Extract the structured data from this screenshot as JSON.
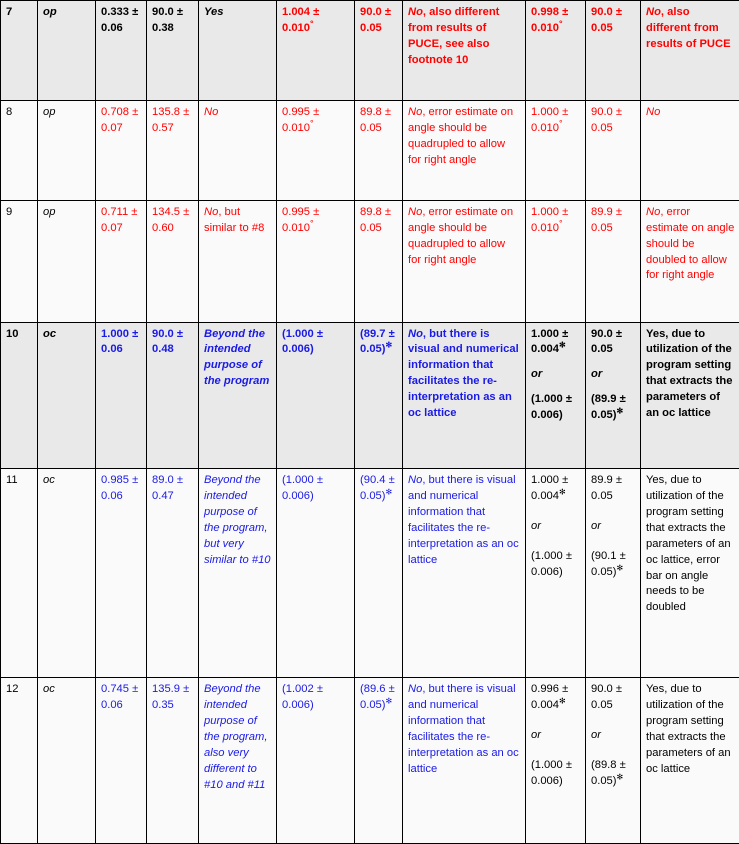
{
  "table": {
    "markers": {
      "degree": "°",
      "star": "✻"
    },
    "colors": {
      "black": "#000000",
      "red": "#ff0000",
      "blue": "#1a1ae6",
      "row_tint_gray": "#e9e9e9",
      "row_tint_white": "#fafafa",
      "border": "#000000"
    },
    "rows": [
      {
        "id": "row-7",
        "tint": "gray",
        "num": "7",
        "lattice": "op",
        "a": "0.333 ± 0.06",
        "b": "90.0 ± 0.38",
        "col5": "Yes",
        "col6": "1.004 ± 0.010°",
        "col7": "90.0 ± 0.05",
        "col8_lead": "No",
        "col8_rest": ", also different from results of PUCE, see also footnote 10",
        "col9": "0.998 ± 0.010°",
        "col10": "90.0 ± 0.05",
        "col11_lead": "No",
        "col11_rest": ", also different from results of PUCE"
      },
      {
        "id": "row-8",
        "tint": "white",
        "num": "8",
        "lattice": "op",
        "a": "0.708 ± 0.07",
        "b": "135.8 ± 0.57",
        "col5": "No",
        "col6": "0.995 ± 0.010°",
        "col7": "89.8 ± 0.05",
        "col8_lead": "No",
        "col8_rest": ", error estimate on angle should be quadrupled to allow for right angle",
        "col9": "1.000 ± 0.010°",
        "col10": "90.0 ± 0.05",
        "col11_lead": "No",
        "col11_rest": ""
      },
      {
        "id": "row-9",
        "tint": "white",
        "num": "9",
        "lattice": "op",
        "a": "0.711 ± 0.07",
        "b": "134.5 ± 0.60",
        "col5_lead": "No",
        "col5_rest": ", but similar to #8",
        "col6": "0.995 ± 0.010°",
        "col7": "89.8 ± 0.05",
        "col8_lead": "No",
        "col8_rest": ", error estimate on angle should be quadrupled to allow for right angle",
        "col9": "1.000 ± 0.010°",
        "col10": "89.9 ± 0.05",
        "col11_lead": "No",
        "col11_rest": ", error estimate on angle should be doubled to allow for right angle"
      },
      {
        "id": "row-10",
        "tint": "gray",
        "num": "10",
        "lattice": "oc",
        "a": "1.000 ± 0.06",
        "b": "90.0 ± 0.48",
        "col5": "Beyond the intended purpose of the program",
        "col6": "(1.000 ± 0.006)",
        "col7": "(89.7 ± 0.05)✻",
        "col8_lead": "No",
        "col8_rest": ", but there is visual and numerical information that facilitates the re-interpretation as an oc lattice",
        "col9_a": "1.000 ± 0.004✻",
        "col9_or": "or",
        "col9_b": "(1.000 ± 0.006)",
        "col10_a": "90.0 ± 0.05",
        "col10_or": "or",
        "col10_b": "(89.9 ± 0.05)✻",
        "col11_lead": "Yes",
        "col11_rest": ", due to utilization of the program setting that extracts the parameters of an oc lattice"
      },
      {
        "id": "row-11",
        "tint": "white",
        "num": "11",
        "lattice": "oc",
        "a": "0.985 ± 0.06",
        "b": "89.0 ± 0.47",
        "col5": "Beyond the intended purpose of the program, but very similar to #10",
        "col6": "(1.000 ± 0.006)",
        "col7": "(90.4 ± 0.05)✻",
        "col8_lead": "No",
        "col8_rest": ", but there is visual and numerical information that facilitates the re-interpretation as an oc lattice",
        "col9_a": "1.000 ± 0.004✻",
        "col9_or": "or",
        "col9_b": "(1.000 ± 0.006)",
        "col10_a": "89.9 ± 0.05",
        "col10_or": "or",
        "col10_b": "(90.1 ± 0.05)✻",
        "col11_lead": "Yes",
        "col11_rest": ", due to utilization of the program setting that extracts the parameters of an oc lattice, error bar on angle needs to be doubled"
      },
      {
        "id": "row-12",
        "tint": "white",
        "num": "12",
        "lattice": "oc",
        "a": "0.745 ± 0.06",
        "b": "135.9 ± 0.35",
        "col5": "Beyond the intended purpose of the program, also very different to #10 and #11",
        "col6": "(1.002 ± 0.006)",
        "col7": "(89.6 ± 0.05)✻",
        "col8_lead": "No",
        "col8_rest": ", but there is visual and numerical information that facilitates the re-interpretation as an oc lattice",
        "col9_a": "0.996 ± 0.004✻",
        "col9_or": "or",
        "col9_b": "(1.000 ± 0.006)",
        "col10_a": "90.0 ± 0.05",
        "col10_or": "or",
        "col10_b": "(89.8 ± 0.05)✻",
        "col11_lead": "Yes",
        "col11_rest": ", due to utilization of the program setting that extracts the parameters of an oc lattice"
      }
    ]
  }
}
